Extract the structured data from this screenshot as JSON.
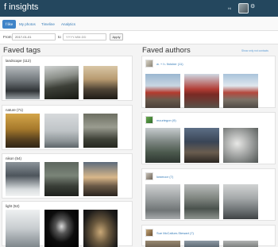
{
  "header": {
    "title": "f insights",
    "greeting": "Hi",
    "avatar_icon": "user-avatar",
    "settings_icon": "gear-icon"
  },
  "tabs": [
    {
      "label": "f like",
      "active": true
    },
    {
      "label": "My photos",
      "active": false
    },
    {
      "label": "Timeline",
      "active": false
    },
    {
      "label": "Analytics",
      "active": false
    }
  ],
  "filter": {
    "from_label": "From",
    "from_value": "2017-01-01",
    "to_label": "to",
    "to_placeholder": "YYYY-MM-DD",
    "apply_label": "Apply"
  },
  "faved_tags": {
    "heading": "Faved tags",
    "tags": [
      {
        "label": "landscape (112)"
      },
      {
        "label": "nature (71)"
      },
      {
        "label": "nikon (54)"
      },
      {
        "label": "light (52)"
      }
    ]
  },
  "faved_authors": {
    "heading": "Faved authors",
    "show_only_contacts": "Show only not contacts",
    "authors": [
      {
        "name": "w. + h. finisher (11)"
      },
      {
        "name": "mcuriegon (9)"
      },
      {
        "name": "lowmoor (7)"
      },
      {
        "name": "Sue McCallum-Stewart (7)"
      }
    ]
  },
  "colors": {
    "header_bg": "#24475e",
    "accent": "#3f84c8",
    "link": "#337ab7"
  }
}
